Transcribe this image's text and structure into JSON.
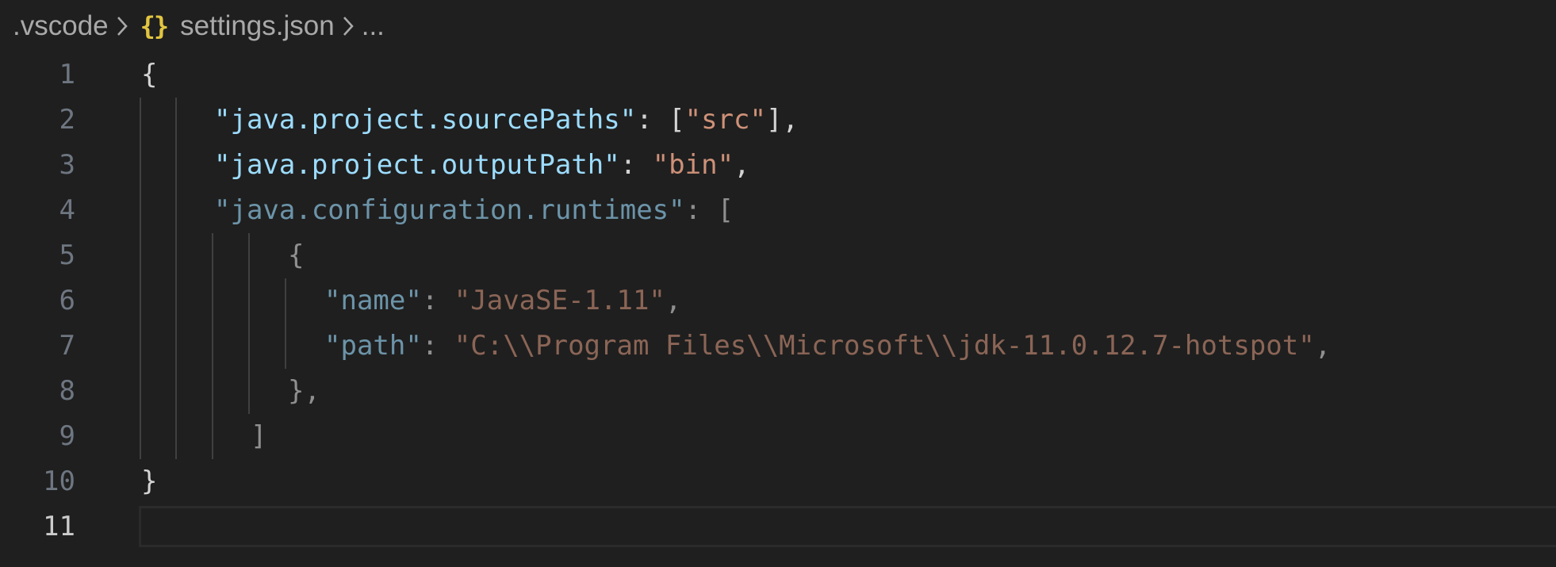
{
  "breadcrumb": {
    "folder": ".vscode",
    "file_icon": "json-braces-icon",
    "file": "settings.json",
    "more": "..."
  },
  "editor": {
    "active_line": 11,
    "lines": [
      {
        "number": "1",
        "tokens": [
          {
            "type": "p",
            "text": "{"
          }
        ]
      },
      {
        "number": "2",
        "tokens": [
          {
            "type": "k",
            "text": "\"java.project.sourcePaths\""
          },
          {
            "type": "p",
            "text": ": ["
          },
          {
            "type": "s",
            "text": "\"src\""
          },
          {
            "type": "p",
            "text": "],"
          }
        ]
      },
      {
        "number": "3",
        "tokens": [
          {
            "type": "k",
            "text": "\"java.project.outputPath\""
          },
          {
            "type": "p",
            "text": ": "
          },
          {
            "type": "s",
            "text": "\"bin\""
          },
          {
            "type": "p",
            "text": ","
          }
        ]
      },
      {
        "number": "4",
        "tokens": [
          {
            "type": "k",
            "text": "\"java.configuration.runtimes\"",
            "dim": true
          },
          {
            "type": "p",
            "text": ": [",
            "dim": true
          }
        ]
      },
      {
        "number": "5",
        "tokens": [
          {
            "type": "p",
            "text": "{",
            "dim": true
          }
        ]
      },
      {
        "number": "6",
        "tokens": [
          {
            "type": "k",
            "text": "\"name\"",
            "dim": true
          },
          {
            "type": "p",
            "text": ": ",
            "dim": true
          },
          {
            "type": "s",
            "text": "\"JavaSE-1.11\"",
            "dim": true
          },
          {
            "type": "p",
            "text": ",",
            "dim": true
          }
        ]
      },
      {
        "number": "7",
        "tokens": [
          {
            "type": "k",
            "text": "\"path\"",
            "dim": true
          },
          {
            "type": "p",
            "text": ": ",
            "dim": true
          },
          {
            "type": "s",
            "text": "\"C:\\\\Program Files\\\\Microsoft\\\\jdk-11.0.12.7-hotspot\"",
            "dim": true
          },
          {
            "type": "p",
            "text": ",",
            "dim": true
          }
        ]
      },
      {
        "number": "8",
        "tokens": [
          {
            "type": "p",
            "text": "},",
            "dim": true
          }
        ]
      },
      {
        "number": "9",
        "tokens": [
          {
            "type": "p",
            "text": "]",
            "dim": true
          }
        ]
      },
      {
        "number": "10",
        "tokens": [
          {
            "type": "p",
            "text": "}"
          }
        ]
      },
      {
        "number": "11",
        "tokens": []
      }
    ]
  },
  "colors": {
    "background": "#1f1f1f",
    "json_key": "#9cdcfe",
    "json_string": "#ce9178",
    "punctuation": "#d4d4d4",
    "json_icon": "#e2c541",
    "line_number": "#6e7681",
    "active_line_number": "#cccccc"
  }
}
